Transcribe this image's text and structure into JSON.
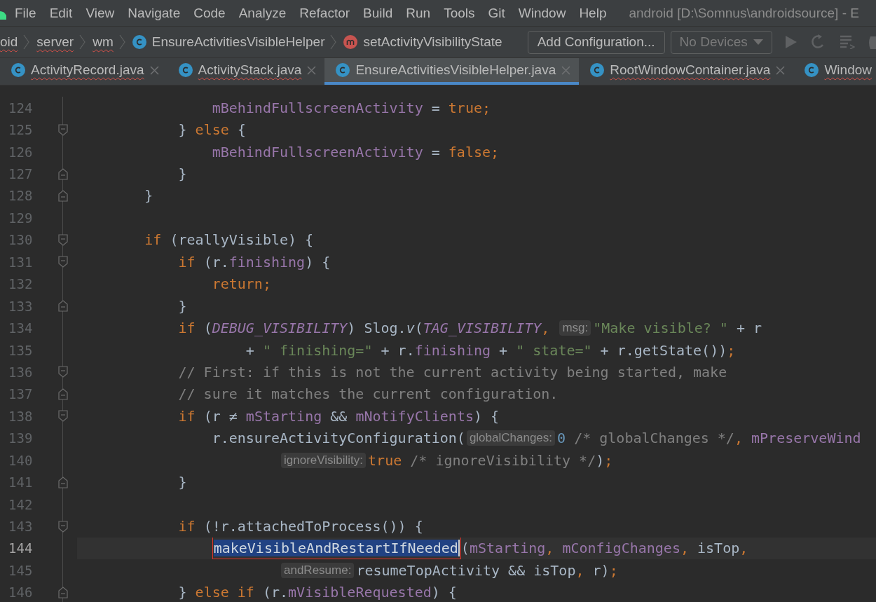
{
  "title_bar": {
    "menu": [
      "File",
      "Edit",
      "View",
      "Navigate",
      "Code",
      "Analyze",
      "Refactor",
      "Build",
      "Run",
      "Tools",
      "Git",
      "Window",
      "Help"
    ],
    "title": "android [D:\\Somnus\\androidsource] - E"
  },
  "navigation_bar": {
    "breadcrumbs": [
      {
        "label": "oid",
        "kind": "package",
        "error": true
      },
      {
        "label": "server",
        "kind": "package",
        "error": true
      },
      {
        "label": "wm",
        "kind": "package",
        "error": true
      },
      {
        "label": "EnsureActivitiesVisibleHelper",
        "kind": "class",
        "error": false
      },
      {
        "label": "setActivityVisibilityState",
        "kind": "method",
        "error": false
      }
    ],
    "configuration_button": "Add Configuration...",
    "device_selector": {
      "value": "No Devices",
      "disabled": true
    }
  },
  "tabs": [
    {
      "label": "ActivityRecord.java",
      "selected": false,
      "error": true,
      "closable": true
    },
    {
      "label": "ActivityStack.java",
      "selected": false,
      "error": true,
      "closable": true
    },
    {
      "label": "EnsureActivitiesVisibleHelper.java",
      "selected": true,
      "error": false,
      "closable": true
    },
    {
      "label": "RootWindowContainer.java",
      "selected": false,
      "error": true,
      "closable": true
    },
    {
      "label": "Window",
      "selected": false,
      "error": true,
      "closable": false
    }
  ],
  "editor": {
    "lines": [
      {
        "number": "124",
        "kind": "plain",
        "current": false,
        "tokens": [
          {
            "text": "                mBehindFullscreenActivity",
            "kind": "field"
          },
          {
            "text": " = ",
            "kind": "plain"
          },
          {
            "text": "true",
            "kind": "keyword"
          },
          {
            "text": ";",
            "kind": "punct"
          }
        ]
      },
      {
        "number": "125",
        "kind": "opener",
        "current": false,
        "tokens": [
          {
            "text": "            } ",
            "kind": "plain"
          },
          {
            "text": "else",
            "kind": "keyword"
          },
          {
            "text": " {",
            "kind": "plain"
          }
        ]
      },
      {
        "number": "126",
        "kind": "plain",
        "current": false,
        "tokens": [
          {
            "text": "                mBehindFullscreenActivity",
            "kind": "field"
          },
          {
            "text": " = ",
            "kind": "plain"
          },
          {
            "text": "false",
            "kind": "keyword"
          },
          {
            "text": ";",
            "kind": "punct"
          }
        ]
      },
      {
        "number": "127",
        "kind": "closer",
        "current": false,
        "tokens": [
          {
            "text": "            }",
            "kind": "plain"
          }
        ]
      },
      {
        "number": "128",
        "kind": "closer",
        "current": false,
        "tokens": [
          {
            "text": "        }",
            "kind": "plain"
          }
        ]
      },
      {
        "number": "129",
        "kind": "plain",
        "current": false
      },
      {
        "number": "130",
        "kind": "opener",
        "current": false,
        "tokens": [
          {
            "text": "        if",
            "kind": "keyword"
          },
          {
            "text": " (reallyVisible) {",
            "kind": "plain"
          }
        ]
      },
      {
        "number": "131",
        "kind": "opener",
        "current": false,
        "tokens": [
          {
            "text": "            if",
            "kind": "keyword"
          },
          {
            "text": " (r.",
            "kind": "plain"
          },
          {
            "text": "finishing",
            "kind": "field"
          },
          {
            "text": ") {",
            "kind": "plain"
          }
        ]
      },
      {
        "number": "132",
        "kind": "plain",
        "current": false,
        "tokens": [
          {
            "text": "                return",
            "kind": "keyword"
          },
          {
            "text": ";",
            "kind": "punct"
          }
        ]
      },
      {
        "number": "133",
        "kind": "closer",
        "current": false,
        "tokens": [
          {
            "text": "            }",
            "kind": "plain"
          }
        ]
      },
      {
        "number": "134",
        "kind": "plain",
        "current": false,
        "tokens": [
          {
            "text": "            if",
            "kind": "keyword"
          },
          {
            "text": " (",
            "kind": "plain"
          },
          {
            "text": "DEBUG_VISIBILITY",
            "kind": "constant"
          },
          {
            "text": ") Slog.",
            "kind": "plain"
          },
          {
            "text": "v",
            "kind": "static"
          },
          {
            "text": "(",
            "kind": "plain"
          },
          {
            "text": "TAG_VISIBILITY",
            "kind": "constant"
          },
          {
            "text": ",",
            "kind": "punct"
          },
          {
            "text": " msg:",
            "kind": "hint"
          },
          {
            "text": "\"Make visible? \"",
            "kind": "string"
          },
          {
            "text": " + r",
            "kind": "plain"
          }
        ]
      },
      {
        "number": "135",
        "kind": "plain",
        "current": false,
        "tokens": [
          {
            "text": "                    + ",
            "kind": "plain"
          },
          {
            "text": "\" finishing=\"",
            "kind": "string"
          },
          {
            "text": " + r.",
            "kind": "plain"
          },
          {
            "text": "finishing",
            "kind": "field"
          },
          {
            "text": " + ",
            "kind": "plain"
          },
          {
            "text": "\" state=\"",
            "kind": "string"
          },
          {
            "text": " + r.getState())",
            "kind": "plain"
          },
          {
            "text": ";",
            "kind": "punct"
          }
        ]
      },
      {
        "number": "136",
        "kind": "opener",
        "current": false,
        "tokens": [
          {
            "text": "            // First: if this is not the current activity being started, make",
            "kind": "comment"
          }
        ]
      },
      {
        "number": "137",
        "kind": "closer",
        "current": false,
        "tokens": [
          {
            "text": "            // sure it matches the current configuration.",
            "kind": "comment"
          }
        ]
      },
      {
        "number": "138",
        "kind": "opener",
        "current": false,
        "tokens": [
          {
            "text": "            if",
            "kind": "keyword"
          },
          {
            "text": " (r ≠ ",
            "kind": "plain"
          },
          {
            "text": "mStarting",
            "kind": "field"
          },
          {
            "text": " && ",
            "kind": "plain"
          },
          {
            "text": "mNotifyClients",
            "kind": "field"
          },
          {
            "text": ") {",
            "kind": "plain"
          }
        ]
      },
      {
        "number": "139",
        "kind": "plain",
        "current": false,
        "tokens": [
          {
            "text": "                r.ensureActivityConfiguration(",
            "kind": "plain"
          },
          {
            "text": "globalChanges:",
            "kind": "hint"
          },
          {
            "text": "0",
            "kind": "number"
          },
          {
            "text": " /* globalChanges */",
            "kind": "comment"
          },
          {
            "text": ", ",
            "kind": "punct"
          },
          {
            "text": "mPreserveWind",
            "kind": "field"
          }
        ]
      },
      {
        "number": "140",
        "kind": "plain",
        "current": false,
        "tokens": [
          {
            "text": "                        ignoreVisibility:",
            "kind": "hint"
          },
          {
            "text": "true",
            "kind": "keyword"
          },
          {
            "text": " /* ignoreVisibility */",
            "kind": "comment"
          },
          {
            "text": ")",
            "kind": "plain"
          },
          {
            "text": ";",
            "kind": "punct"
          }
        ]
      },
      {
        "number": "141",
        "kind": "closer",
        "current": false,
        "tokens": [
          {
            "text": "            }",
            "kind": "plain"
          }
        ]
      },
      {
        "number": "142",
        "kind": "plain",
        "current": false
      },
      {
        "number": "143",
        "kind": "opener",
        "current": false,
        "tokens": [
          {
            "text": "            if",
            "kind": "keyword"
          },
          {
            "text": " (!r.attachedToProcess()) {",
            "kind": "plain"
          }
        ]
      },
      {
        "number": "144",
        "kind": "plain",
        "current": true,
        "tokens": [
          {
            "text": "                makeVisibleAndRestartIfNeeded",
            "kind": "selected"
          },
          {
            "text": "(",
            "kind": "plain"
          },
          {
            "text": "mStarting",
            "kind": "field"
          },
          {
            "text": ", ",
            "kind": "punct"
          },
          {
            "text": "mConfigChanges",
            "kind": "field"
          },
          {
            "text": ",",
            "kind": "punct"
          },
          {
            "text": " isTop",
            "kind": "plain"
          },
          {
            "text": ",",
            "kind": "punct"
          }
        ]
      },
      {
        "number": "145",
        "kind": "plain",
        "current": false,
        "tokens": [
          {
            "text": "                        andResume:",
            "kind": "hint"
          },
          {
            "text": "resumeTopActivity && isTop",
            "kind": "plain"
          },
          {
            "text": ",",
            "kind": "punct"
          },
          {
            "text": " r)",
            "kind": "plain"
          },
          {
            "text": ";",
            "kind": "punct"
          }
        ]
      },
      {
        "number": "146",
        "kind": "closer",
        "current": false,
        "tokens": [
          {
            "text": "            } ",
            "kind": "plain"
          },
          {
            "text": "else if",
            "kind": "keyword"
          },
          {
            "text": " (r.",
            "kind": "plain"
          },
          {
            "text": "mVisibleRequested",
            "kind": "field"
          },
          {
            "text": ") {",
            "kind": "plain"
          }
        ]
      }
    ]
  }
}
